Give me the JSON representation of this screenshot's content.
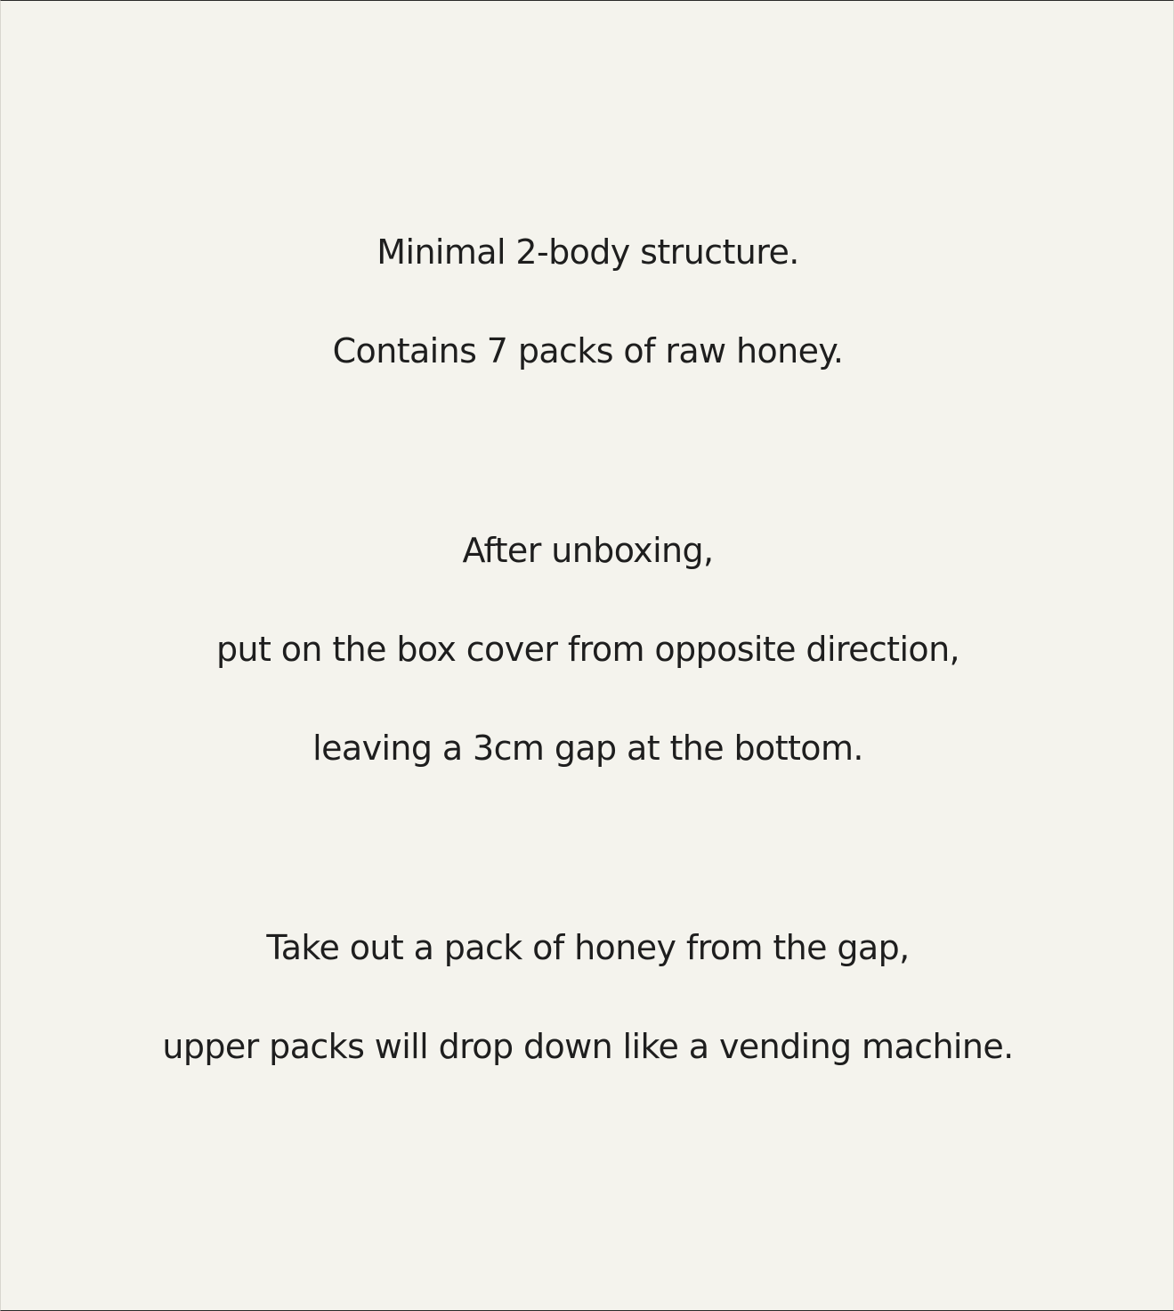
{
  "paragraphs": [
    {
      "lines": [
        "Minimal 2-body structure.",
        "Contains 7 packs of raw honey."
      ]
    },
    {
      "lines": [
        "After unboxing,",
        "put on the box cover from opposite direction,",
        "leaving a 3cm gap at the bottom."
      ]
    },
    {
      "lines": [
        "Take out a pack of honey from the gap,",
        "upper packs will drop down like a vending machine."
      ]
    }
  ],
  "colors": {
    "background": "#f4f3ed",
    "text": "#1e1e1e"
  }
}
